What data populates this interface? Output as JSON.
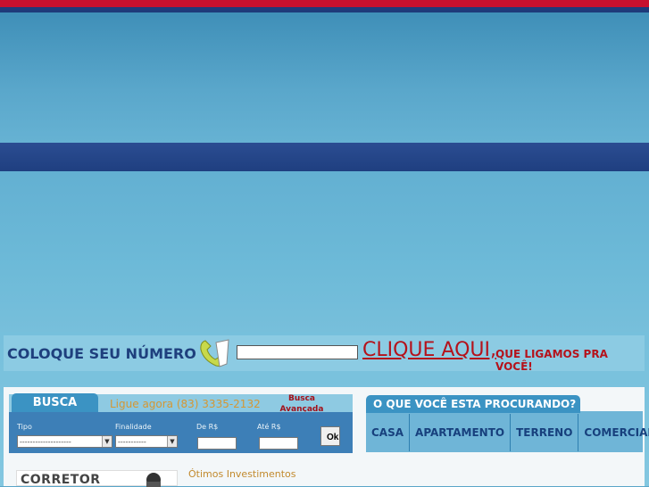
{
  "callbar": {
    "title": "COLOQUE SEU NÚMERO",
    "phone_value": "",
    "cta": "CLIQUE AQUI,",
    "cta_suffix": "QUE LIGAMOS PRA VOCÊ!"
  },
  "busca": {
    "tab_label": "BUSCA",
    "ligue_text": "Ligue agora (83) 3335-2132",
    "avancada_label": "Busca Avançada",
    "tipo_label": "Tipo",
    "tipo_value": "--------------------",
    "finalidade_label": "Finalidade",
    "finalidade_value": "-----------",
    "de_label": "De R$",
    "ate_label": "Até R$",
    "ok_label": "Ok"
  },
  "procura": {
    "title": "O QUE VOCÊ ESTA PROCURANDO?",
    "categories": [
      "CASA",
      "APARTAMENTO",
      "TERRENO",
      "COMERCIAL"
    ]
  },
  "corretor": {
    "label": "CORRETOR"
  },
  "section": {
    "otimos": "Ótimos Investimentos"
  },
  "colors": {
    "brand_blue": "#1e3f7d",
    "accent_red": "#b5121b",
    "tab_blue": "#3b93c3"
  }
}
